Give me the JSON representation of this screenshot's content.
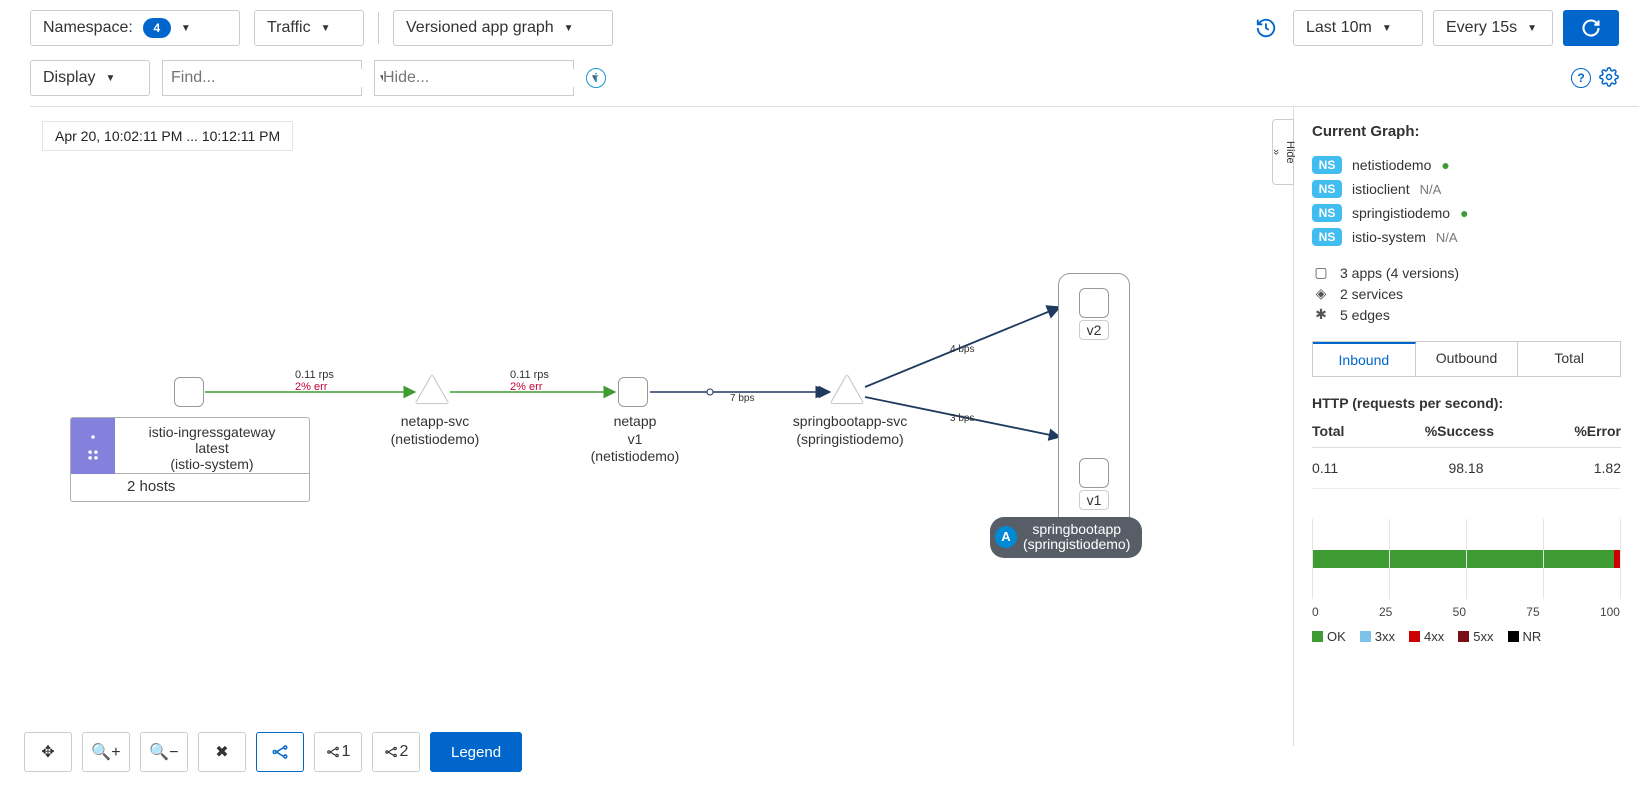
{
  "toolbar": {
    "namespace_label": "Namespace:",
    "namespace_count": "4",
    "traffic_label": "Traffic",
    "graph_type": "Versioned app graph",
    "time_range": "Last 10m",
    "interval": "Every 15s",
    "display": "Display",
    "find_placeholder": "Find...",
    "hide_placeholder": "Hide..."
  },
  "graph": {
    "time_window": "Apr 20, 10:02:11 PM ... 10:12:11 PM",
    "hide_tab": "Hide",
    "nodes": {
      "igw": {
        "title": "istio-ingressgateway",
        "ver": "latest",
        "ns": "(istio-system)",
        "hosts": "2 hosts"
      },
      "netapp_svc": {
        "title": "netapp-svc",
        "ns": "(netistiodemo)"
      },
      "netapp": {
        "title": "netapp",
        "ver": "v1",
        "ns": "(netistiodemo)"
      },
      "spring_svc": {
        "title": "springbootapp-svc",
        "ns": "(springistiodemo)"
      },
      "spring_app": {
        "pill_letter": "A",
        "title": "springbootapp",
        "ns": "(springistiodemo)",
        "v1": "v1",
        "v2": "v2"
      }
    },
    "edges": {
      "e1": {
        "rps": "0.11 rps",
        "err": "2% err"
      },
      "e2": {
        "rps": "0.11 rps",
        "err": "2% err"
      },
      "e3": {
        "bps": "7 bps"
      },
      "e4": {
        "bps": "4 bps"
      },
      "e5": {
        "bps": "3 bps"
      }
    }
  },
  "side": {
    "title": "Current Graph:",
    "namespaces": [
      {
        "name": "netistiodemo",
        "status": "ok"
      },
      {
        "name": "istioclient",
        "status": "N/A"
      },
      {
        "name": "springistiodemo",
        "status": "ok"
      },
      {
        "name": "istio-system",
        "status": "N/A"
      }
    ],
    "summary": {
      "apps": "3 apps (4 versions)",
      "services": "2 services",
      "edges": "5 edges"
    },
    "tabs": {
      "inbound": "Inbound",
      "outbound": "Outbound",
      "total": "Total"
    },
    "http_title": "HTTP (requests per second):",
    "metrics_head": {
      "total": "Total",
      "success": "%Success",
      "error": "%Error"
    },
    "metrics_row": {
      "total": "0.11",
      "success": "98.18",
      "error": "1.82"
    },
    "axis": [
      "0",
      "25",
      "50",
      "75",
      "100"
    ],
    "legend": {
      "ok": "OK",
      "3xx": "3xx",
      "4xx": "4xx",
      "5xx": "5xx",
      "nr": "NR"
    }
  },
  "bottom": {
    "legend": "Legend",
    "lbl1": "1",
    "lbl2": "2"
  },
  "chart_data": {
    "type": "bar",
    "title": "HTTP (requests per second)",
    "categories": [
      "OK",
      "3xx",
      "4xx",
      "5xx",
      "NR"
    ],
    "values": [
      98.18,
      0,
      0,
      1.82,
      0
    ],
    "xlim": [
      0,
      100
    ],
    "xlabel": "",
    "ylabel": ""
  }
}
